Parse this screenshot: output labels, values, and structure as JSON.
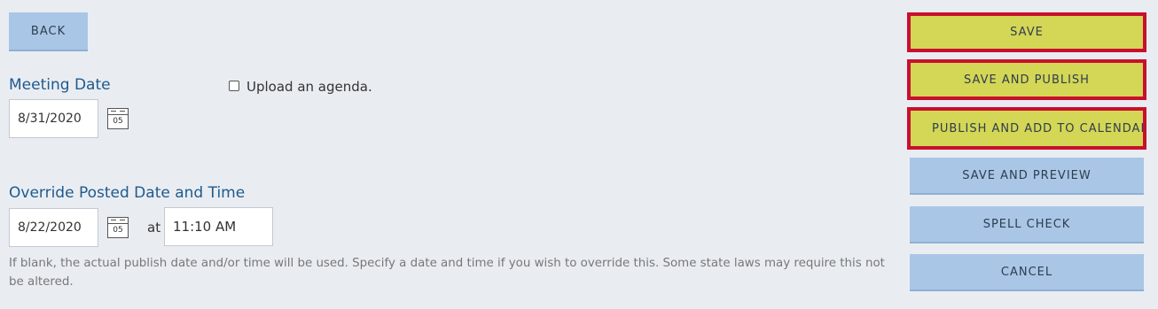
{
  "left": {
    "back_label": "BACK",
    "meeting_date_label": "Meeting Date",
    "meeting_date_value": "8/31/2020",
    "calendar_day": "05",
    "upload_agenda_label": "Upload an agenda.",
    "override_label": "Override Posted Date and Time",
    "override_date_value": "8/22/2020",
    "at_label": "at",
    "override_time_value": "11:10 AM",
    "help_text": "If blank, the actual publish date and/or time will be used. Specify a date and time if you wish to override this. Some state laws may require this not be altered."
  },
  "actions": {
    "save": "SAVE",
    "save_publish": "SAVE AND PUBLISH",
    "publish_calendar": "PUBLISH AND ADD TO CALENDAR",
    "save_preview": "SAVE AND PREVIEW",
    "spell_check": "SPELL CHECK",
    "cancel": "CANCEL"
  },
  "colors": {
    "highlight_border": "#c8102e",
    "highlight_fill": "#d4d655",
    "button_blue": "#a9c6e6",
    "label_blue": "#1f5a8c"
  }
}
